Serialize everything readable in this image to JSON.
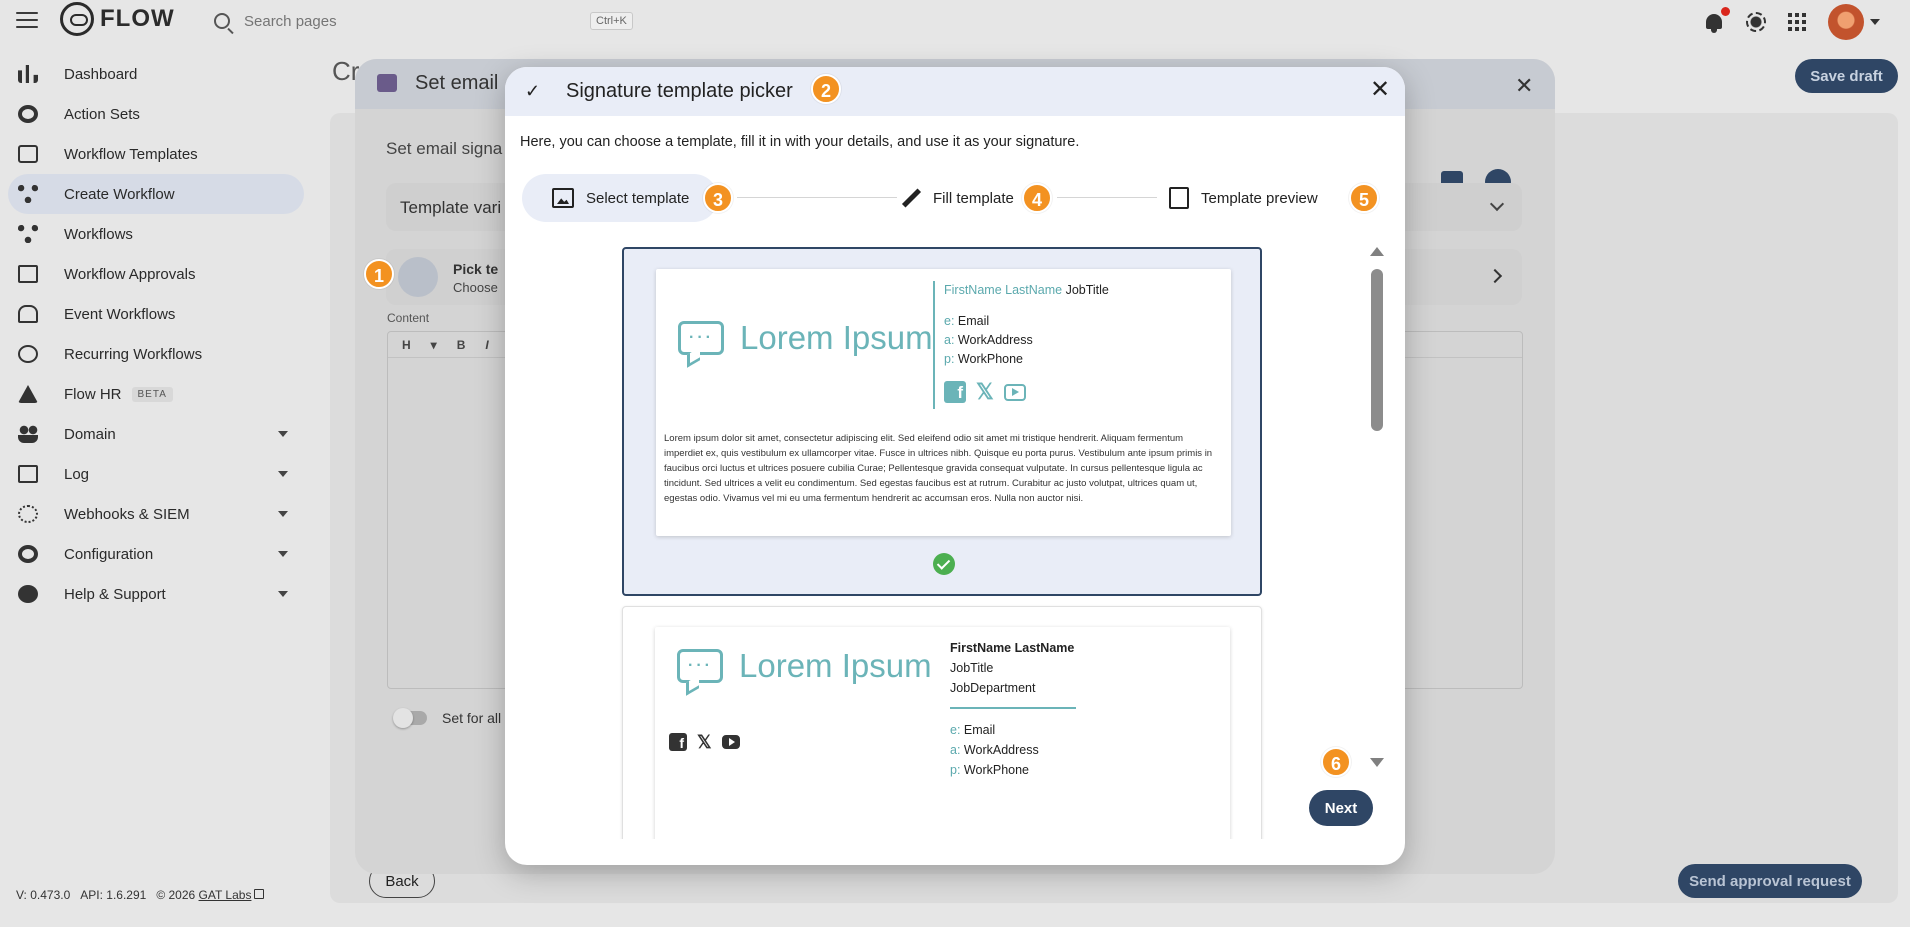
{
  "app": {
    "name": "FLOW",
    "search_placeholder": "Search pages",
    "search_shortcut": "Ctrl+K"
  },
  "sidebar": {
    "items": [
      {
        "label": "Dashboard",
        "icon": "bar-chart-icon"
      },
      {
        "label": "Action Sets",
        "icon": "gears-icon"
      },
      {
        "label": "Workflow Templates",
        "icon": "template-icon"
      },
      {
        "label": "Create Workflow",
        "icon": "fork-icon",
        "active": true
      },
      {
        "label": "Workflows",
        "icon": "workflows-icon"
      },
      {
        "label": "Workflow Approvals",
        "icon": "approval-icon"
      },
      {
        "label": "Event Workflows",
        "icon": "alarm-icon"
      },
      {
        "label": "Recurring Workflows",
        "icon": "clock-icon"
      },
      {
        "label": "Flow HR",
        "icon": "hr-icon",
        "badge": "BETA"
      },
      {
        "label": "Domain",
        "icon": "people-icon",
        "expandable": true
      },
      {
        "label": "Log",
        "icon": "log-icon",
        "expandable": true
      },
      {
        "label": "Webhooks & SIEM",
        "icon": "webhook-icon",
        "expandable": true
      },
      {
        "label": "Configuration",
        "icon": "gear-icon",
        "expandable": true
      },
      {
        "label": "Help & Support",
        "icon": "help-icon",
        "expandable": true
      }
    ]
  },
  "footer": {
    "version": "V: 0.473.0",
    "api": "API: 1.6.291",
    "copyright": "© 2026",
    "company": "GAT Labs"
  },
  "page": {
    "title": "Cr",
    "save_draft": "Save draft",
    "back": "Back",
    "send_approval": "Send approval request"
  },
  "email_modal": {
    "title": "Set email",
    "subtitle": "Set email signa",
    "template_vars": "Template vari",
    "pick_title": "Pick te",
    "pick_sub": "Choose",
    "content_label": "Content",
    "toolbar": [
      "H",
      "▾",
      "B",
      "I"
    ],
    "toggle_label": "Set for all"
  },
  "picker": {
    "title": "Signature template picker",
    "intro": "Here, you can choose a template, fill it in with your details, and use it as your signature.",
    "steps": [
      {
        "label": "Select template",
        "icon": "image-icon",
        "active": true
      },
      {
        "label": "Fill template",
        "icon": "pencil-icon"
      },
      {
        "label": "Template preview",
        "icon": "preview-icon"
      }
    ],
    "next": "Next",
    "templates": [
      {
        "logo": "Lorem Ipsum",
        "first_last": "FirstName LastName",
        "job_title": "JobTitle",
        "email_key": "e:",
        "email": "Email",
        "address_key": "a:",
        "address": "WorkAddress",
        "phone_key": "p:",
        "phone": "WorkPhone",
        "paragraph": "Lorem ipsum dolor sit amet, consectetur adipiscing elit. Sed eleifend odio sit amet mi tristique hendrerit. Aliquam fermentum imperdiet ex, quis vestibulum ex ullamcorper vitae. Fusce in ultrices nibh. Quisque eu porta purus. Vestibulum ante ipsum primis in faucibus orci luctus et ultrices posuere cubilia Curae; Pellentesque gravida consequat vulputate. In cursus pellentesque ligula ac tincidunt. Sed ultrices a velit eu condimentum. Sed egestas faucibus est at rutrum. Curabitur ac justo volutpat, ultrices quam ut, egestas odio. Vivamus vel mi eu uma fermentum hendrerit ac accumsan eros. Nulla non auctor nisi.",
        "selected": true
      },
      {
        "logo": "Lorem Ipsum",
        "first_last": "FirstName LastName",
        "job_title": "JobTitle",
        "department": "JobDepartment",
        "email_key": "e:",
        "email": "Email",
        "address_key": "a:",
        "address": "WorkAddress",
        "phone_key": "p:",
        "phone": "WorkPhone"
      }
    ]
  },
  "annotations": [
    "1",
    "2",
    "3",
    "4",
    "5",
    "6"
  ],
  "colors": {
    "accent": "#2f4665",
    "teal": "#6bb4b8",
    "badge": "#f39221",
    "selected_bg": "#e9edf7",
    "check": "#4caf50"
  }
}
